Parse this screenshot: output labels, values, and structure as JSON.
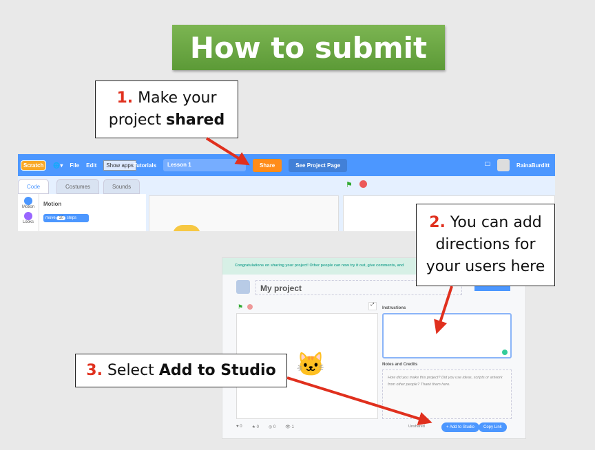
{
  "slide": {
    "title": "How to submit"
  },
  "callouts": [
    {
      "number": "1.",
      "text_before": "Make your",
      "text_line2": "project ",
      "bold": "shared"
    },
    {
      "number": "2.",
      "line1": "You can add",
      "line2": "directions for",
      "line3": "your users here"
    },
    {
      "number": "3.",
      "text": "Select ",
      "bold": "Add to Studio"
    }
  ],
  "editor": {
    "logo": "Scratch",
    "menu": [
      "File",
      "Edit",
      "Tutorials"
    ],
    "tooltip": "Show apps",
    "project_title": "Lesson 1",
    "share": "Share",
    "see_page": "See Project Page",
    "username": "RainaBurditt",
    "tabs": [
      "Code",
      "Costumes",
      "Sounds"
    ],
    "categories": [
      "Motion",
      "Looks"
    ],
    "palette_title": "Motion",
    "block": {
      "prefix": "move",
      "value": "10",
      "suffix": "steps"
    }
  },
  "share_page": {
    "banner": "Congratulations on sharing your project! Other people can now try it out, give comments, and",
    "project_name": "My project",
    "instructions_label": "Instructions",
    "notes_label": "Notes and Credits",
    "notes_placeholder": "How did you make this project? Did you use ideas, scripts or artwork from other people? Thank them here.",
    "stats": {
      "loves": "0",
      "favorites": "0",
      "remixes": "0",
      "views": "1"
    },
    "unshared": "Unshared",
    "add_to_studio": "+ Add to Studio",
    "copy_link": "Copy Link"
  },
  "colors": {
    "scratch_blue": "#4c97ff",
    "share_orange": "#ff8c1a",
    "arrow_red": "#e0301e",
    "title_green": "#6aa843"
  }
}
